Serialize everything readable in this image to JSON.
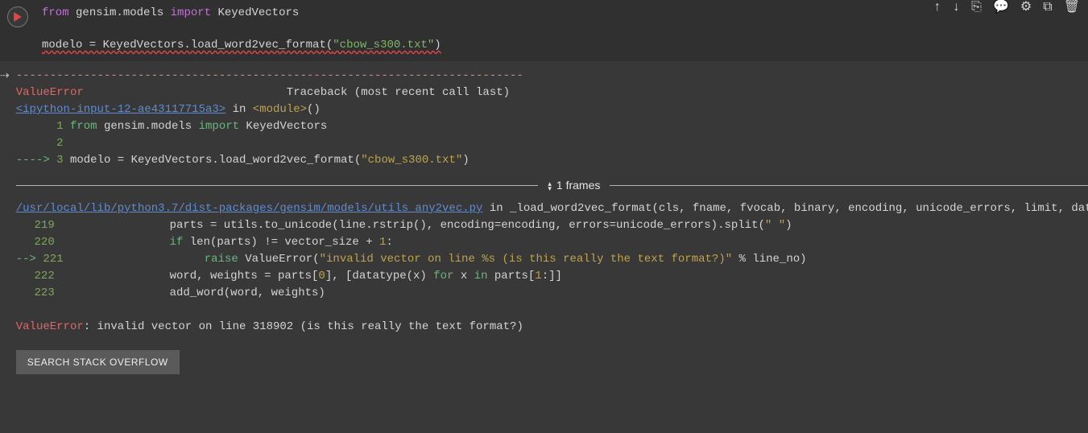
{
  "toolbar_icons": {
    "move_up": "↑",
    "move_down": "↓",
    "link": "⎘",
    "comment": "💬",
    "settings": "⚙",
    "mirror": "⧉",
    "delete": "🗑"
  },
  "code": {
    "line1": {
      "kw1": "from",
      "mod": " gensim.models ",
      "kw2": "import",
      "cls": " KeyedVectors"
    },
    "line2_lhs": "modelo = KeyedVectors.load_word2vec_format(",
    "line2_str": "\"cbow_s300.txt\"",
    "line2_rhs": ")"
  },
  "traceback": {
    "dashes": "---------------------------------------------------------------------------",
    "err_name": "ValueError",
    "trace_label": "                              Traceback (most recent call last)",
    "ipy_link": "<ipython-input-12-ae43117715a3>",
    "in_module_label": " in ",
    "module_tag": "<module>",
    "after_module": "()",
    "src1_num": "1",
    "src1_kw_from": "from",
    "src1_mid": " gensim.models ",
    "src1_kw_import": "import",
    "src1_rest": " KeyedVectors",
    "src2_num": "2",
    "src3_arrow": "----> ",
    "src3_num": "3",
    "src3_code_a": " modelo = KeyedVectors.load_word2vec_format(",
    "src3_str": "\"cbow_s300.txt\"",
    "src3_code_b": ")",
    "frames_label": "1 frames",
    "file_link": "/usr/local/lib/python3.7/dist-packages/gensim/models/utils_any2vec.py",
    "func_suffix_a": " in _load_word2vec_format",
    "func_args": "(cls, fname, fvocab, binary, encoding, unicode_errors, limit, datatype)",
    "l219_num": "219",
    "l219_code_a": "                parts = utils.to_unicode(line.rstrip(), encoding=encoding, errors=unicode_errors).split(",
    "l219_str": "\" \"",
    "l219_code_b": ")",
    "l220_num": "220",
    "l220_code_a": "                ",
    "l220_kw_if": "if",
    "l220_code_b": " len(parts) != vector_size + ",
    "l220_one": "1",
    "l220_colon": ":",
    "l221_arrow": "--> ",
    "l221_num": "221",
    "l221_code_a": "                    ",
    "l221_kw_raise": "raise",
    "l221_code_b": " ValueError(",
    "l221_str": "\"invalid vector on line %s (is this really the text format?)\"",
    "l221_code_c": " % line_no)",
    "l222_num": "222",
    "l222_code_a": "                word, weights = parts[",
    "l222_zero": "0",
    "l222_code_b": "], [datatype(x) ",
    "l222_kw_for": "for",
    "l222_code_c": " x ",
    "l222_kw_in": "in",
    "l222_code_d": " parts[",
    "l222_one": "1",
    "l222_code_e": ":]]",
    "l223_num": "223",
    "l223_code": "                add_word(word, weights)",
    "final_err": "ValueError",
    "final_msg": ": invalid vector on line 318902 (is this really the text format?)"
  },
  "buttons": {
    "search_so": "SEARCH STACK OVERFLOW"
  }
}
